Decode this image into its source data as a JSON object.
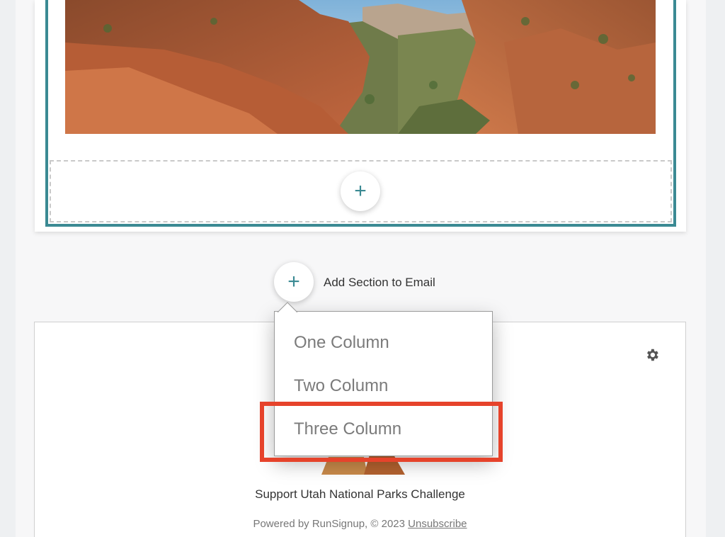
{
  "add_section": {
    "label": "Add Section to Email",
    "plus_glyph": "+"
  },
  "drop_zone": {
    "plus_glyph": "+"
  },
  "section_menu": {
    "items": [
      "One Column",
      "Two Column",
      "Three Column"
    ],
    "highlighted": "Three Column"
  },
  "footer": {
    "title": "Support Utah National Parks Challenge",
    "powered_by": "Powered by RunSignup, © 2023",
    "unsubscribe": "Unsubscribe"
  },
  "colors": {
    "accent": "#3b8a93",
    "highlight": "#e6432b"
  },
  "icons": [
    "plus-icon",
    "gear-icon"
  ]
}
